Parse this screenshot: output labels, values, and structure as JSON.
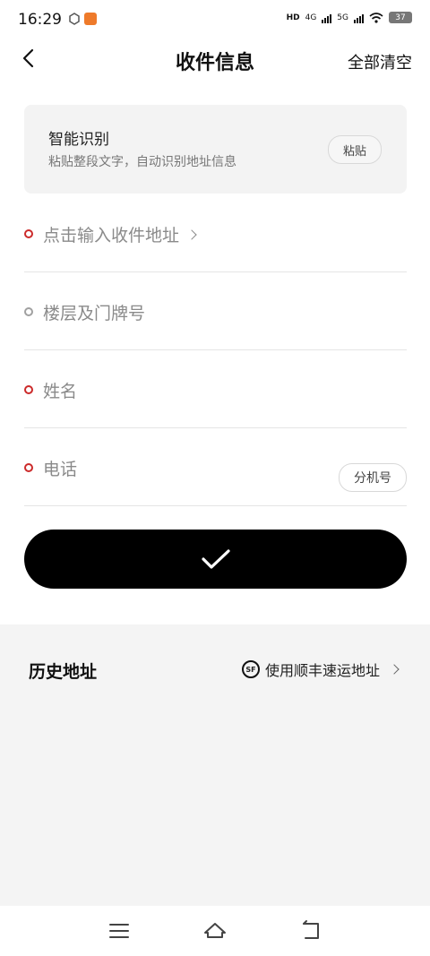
{
  "status_bar": {
    "time": "16:29",
    "network_labels": [
      "HD",
      "4G",
      "5G"
    ],
    "battery": "37"
  },
  "header": {
    "title": "收件信息",
    "clear_all": "全部清空"
  },
  "smart_recognition": {
    "title": "智能识别",
    "subtitle": "粘贴整段文字，自动识别地址信息",
    "paste_button": "粘贴"
  },
  "form": {
    "address_placeholder": "点击输入收件地址",
    "floor_placeholder": "楼层及门牌号",
    "name_placeholder": "姓名",
    "phone_placeholder": "电话",
    "extension_button": "分机号"
  },
  "history": {
    "title": "历史地址",
    "sf_logo": "SF",
    "sf_link": "使用顺丰速运地址"
  },
  "colors": {
    "required_dot": "#cc2a2a",
    "confirm_bg": "#000000",
    "history_bg": "#f4f4f4"
  }
}
